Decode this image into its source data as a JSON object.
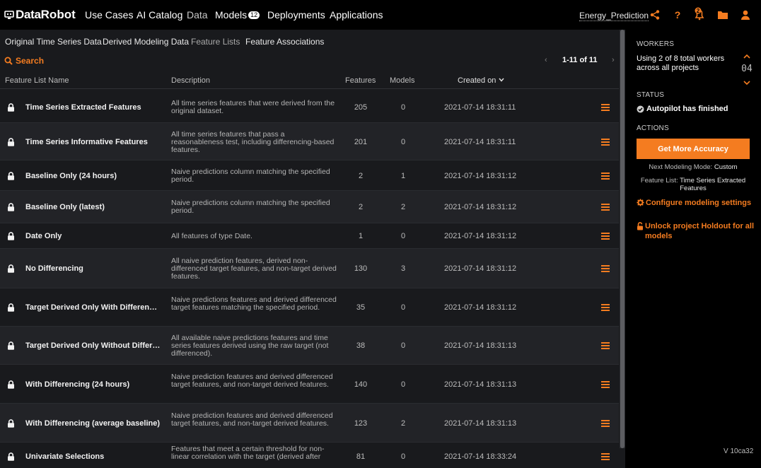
{
  "nav": {
    "brand_a": "Data",
    "brand_b": "Robot",
    "items": [
      {
        "label": "Use Cases"
      },
      {
        "label": "AI Catalog"
      },
      {
        "label": "Data"
      },
      {
        "label": "Models"
      },
      {
        "label": "Deployments"
      },
      {
        "label": "Applications"
      }
    ],
    "models_badge": "12",
    "project_name": "Energy_Prediction",
    "notification_count": "2"
  },
  "subnav": {
    "tabs": [
      {
        "label": "Original Time Series Data"
      },
      {
        "label": "Derived Modeling Data"
      },
      {
        "label": "Feature Lists"
      },
      {
        "label": "Feature Associations"
      }
    ],
    "search_label": "Search",
    "pager": {
      "prev": "‹",
      "range": "1-11 of 11",
      "next": "›"
    }
  },
  "table": {
    "headers": {
      "name": "Feature List Name",
      "description": "Description",
      "features": "Features",
      "models": "Models",
      "created": "Created on"
    },
    "rows": [
      {
        "name": "Time Series Extracted Features",
        "description": "All time series features that were derived from the original dataset.",
        "features": "205",
        "models": "0",
        "created": "2021-07-14 18:31:11"
      },
      {
        "name": "Time Series Informative Features",
        "description": "All time series features that pass a reasonableness test, including differencing-based features.",
        "features": "201",
        "models": "0",
        "created": "2021-07-14 18:31:11"
      },
      {
        "name": "Baseline Only (24 hours)",
        "description": "Naive predictions column matching the specified period.",
        "features": "2",
        "models": "1",
        "created": "2021-07-14 18:31:12"
      },
      {
        "name": "Baseline Only (latest)",
        "description": "Naive predictions column matching the specified period.",
        "features": "2",
        "models": "2",
        "created": "2021-07-14 18:31:12"
      },
      {
        "name": "Date Only",
        "description": "All features of type Date.",
        "features": "1",
        "models": "0",
        "created": "2021-07-14 18:31:12"
      },
      {
        "name": "No Differencing",
        "description": "All naive prediction features, derived non-differenced target features, and non-target derived features.",
        "features": "130",
        "models": "3",
        "created": "2021-07-14 18:31:12"
      },
      {
        "name": "Target Derived Only With Differencing...",
        "description": "Naive predictions features and derived differenced target features matching the specified period.",
        "features": "35",
        "models": "0",
        "created": "2021-07-14 18:31:12"
      },
      {
        "name": "Target Derived Only Without Differen...",
        "description": "All available naive predictions features and time series features derived using the raw target (not differenced).",
        "features": "38",
        "models": "0",
        "created": "2021-07-14 18:31:13"
      },
      {
        "name": "With Differencing (24 hours)",
        "description": "Naive prediction features and derived differenced target features, and non-target derived features.",
        "features": "140",
        "models": "0",
        "created": "2021-07-14 18:31:13"
      },
      {
        "name": "With Differencing (average baseline)",
        "description": "Naive prediction features and derived differenced target features, and non-target derived features.",
        "features": "123",
        "models": "2",
        "created": "2021-07-14 18:31:13"
      },
      {
        "name": "Univariate Selections",
        "description": "Features that meet a certain threshold for non-linear correlation with the target (derived after",
        "features": "81",
        "models": "0",
        "created": "2021-07-14 18:33:24"
      }
    ]
  },
  "panel": {
    "workers_heading": "WORKERS",
    "workers_text": "Using 2 of 8 total workers across all projects",
    "workers_count": "04",
    "status_heading": "STATUS",
    "status_text": "Autopilot has finished",
    "actions_heading": "ACTIONS",
    "accuracy_button": "Get More Accuracy",
    "next_mode_label": "Next Modeling Mode:",
    "next_mode_value": "Custom",
    "feature_list_label": "Feature List:",
    "feature_list_value": "Time Series Extracted Features",
    "configure_link": "Configure modeling settings",
    "unlock_link": "Unlock project Holdout for all models",
    "version": "V 10ca32"
  },
  "colors": {
    "accent": "#f47c20",
    "nav_bg": "#000000",
    "body_bg": "#191a1d"
  }
}
